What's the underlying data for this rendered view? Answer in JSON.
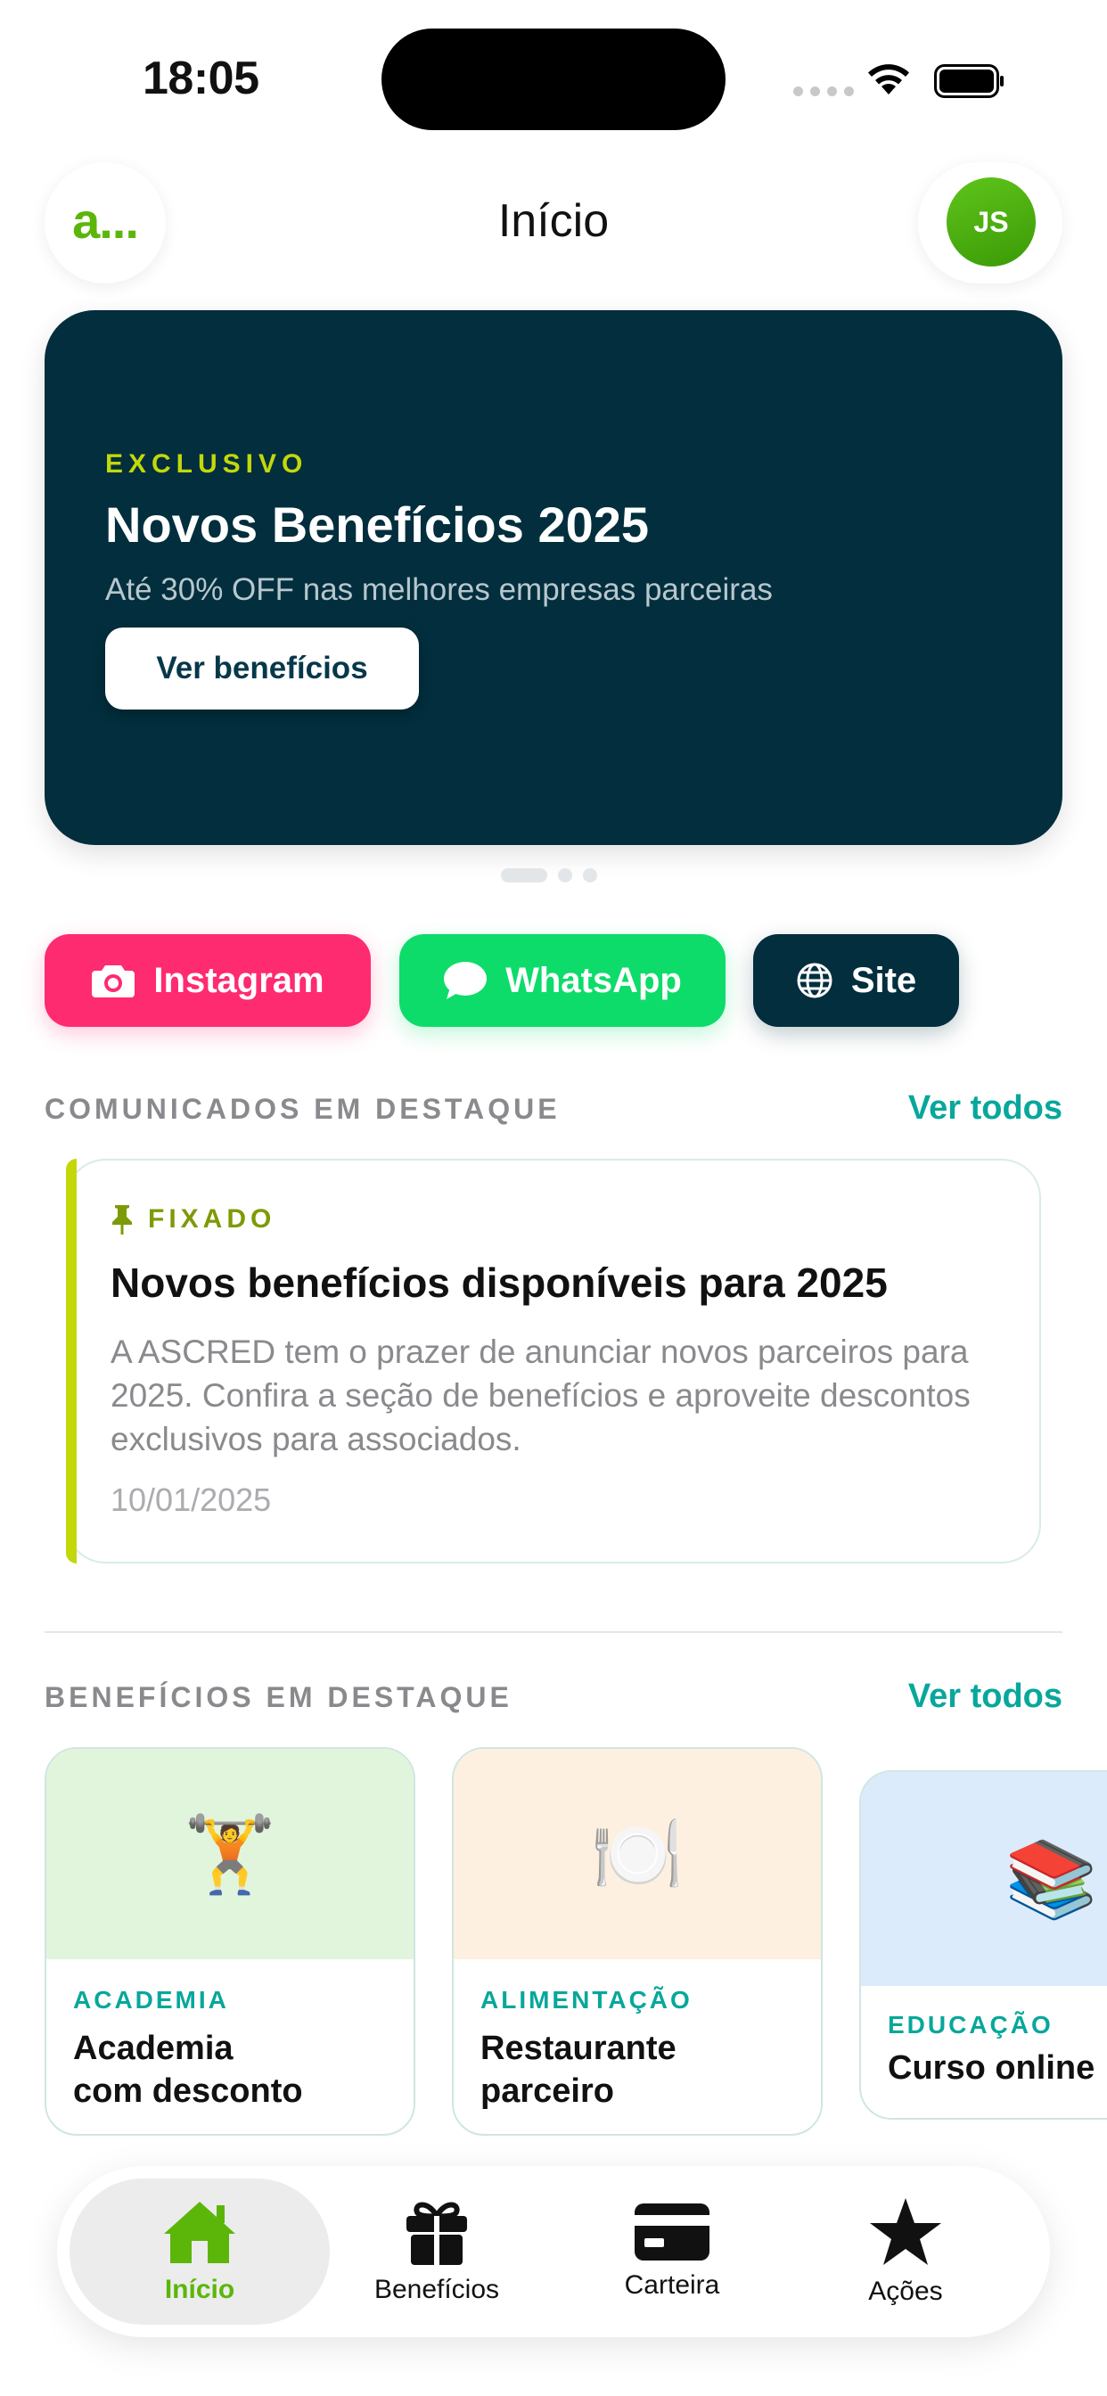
{
  "status_bar": {
    "time": "18:05"
  },
  "header": {
    "logo_text": "a...",
    "title": "Início",
    "avatar_initials": "JS"
  },
  "hero": {
    "kicker": "EXCLUSIVO",
    "title": "Novos Benefícios 2025",
    "subtitle": "Até 30% OFF nas melhores empresas parceiras",
    "button_label": "Ver benefícios",
    "carousel_active_index": 0,
    "carousel_count": 3
  },
  "social": [
    {
      "label": "Instagram",
      "icon": "camera-icon",
      "color": "#fe2b70"
    },
    {
      "label": "WhatsApp",
      "icon": "chat-bubble-icon",
      "color": "#0ddc6a"
    },
    {
      "label": "Site",
      "icon": "globe-icon",
      "color": "#022e3d"
    }
  ],
  "announcements": {
    "section_title": "COMUNICADOS EM DESTAQUE",
    "see_all": "Ver todos",
    "items": [
      {
        "badge": "FIXADO",
        "title": "Novos benefícios disponíveis para 2025",
        "body": "A ASCRED tem o prazer de anunciar novos parceiros para 2025. Confira a seção de benefícios e aproveite descontos exclusivos para associados.",
        "date": "10/01/2025"
      }
    ]
  },
  "benefits": {
    "section_title": "BENEFÍCIOS EM DESTAQUE",
    "see_all": "Ver todos",
    "items": [
      {
        "category": "ACADEMIA",
        "title_line1": "Academia",
        "title_line2": "com desconto",
        "emoji": "🏋️",
        "bg": "#e1f5dd"
      },
      {
        "category": "ALIMENTAÇÃO",
        "title_line1": "Restaurante",
        "title_line2": "parceiro",
        "emoji": "🍽️",
        "bg": "#fdf0e0"
      },
      {
        "category": "EDUCAÇÃO",
        "title_line1": "Curso online",
        "title_line2": "",
        "emoji": "📚",
        "bg": "#dcebfb"
      }
    ]
  },
  "tabbar": {
    "active": "inicio",
    "items": [
      {
        "id": "inicio",
        "label": "Início",
        "icon": "house-icon"
      },
      {
        "id": "beneficios",
        "label": "Benefícios",
        "icon": "gift-icon"
      },
      {
        "id": "carteira",
        "label": "Carteira",
        "icon": "card-icon"
      },
      {
        "id": "acoes",
        "label": "Ações",
        "icon": "star-icon"
      }
    ]
  },
  "colors": {
    "brand_green": "#5cb60a",
    "teal": "#08a79b",
    "lime": "#c2d80a",
    "navy": "#022e3d"
  }
}
